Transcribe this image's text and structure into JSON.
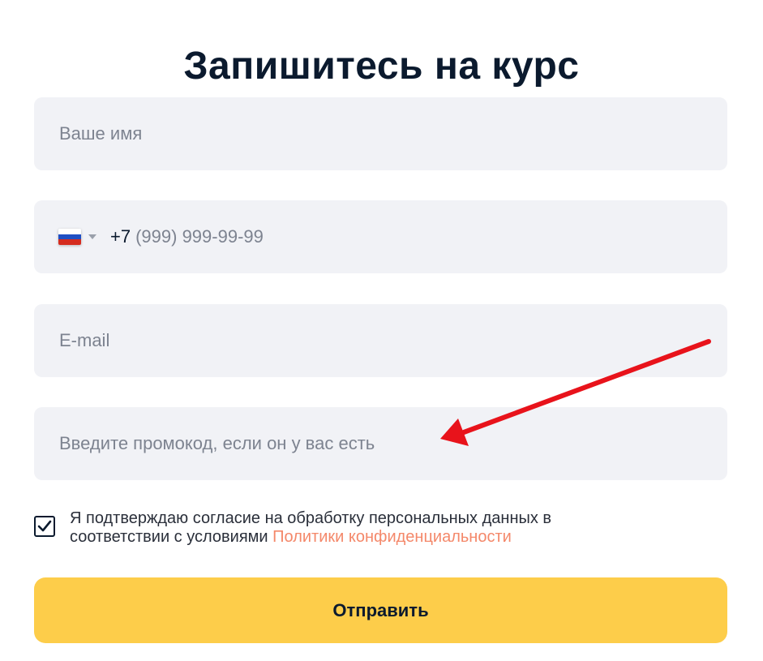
{
  "title": "Запишитесь на курс",
  "fields": {
    "name_placeholder": "Ваше имя",
    "phone_prefix": "+7",
    "phone_placeholder": "(999) 999-99-99",
    "email_placeholder": "E-mail",
    "promo_placeholder": "Введите промокод, если он у вас есть"
  },
  "consent": {
    "checked": true,
    "text": "Я подтверждаю согласие на обработку персональных данных в соответствии с условиями ",
    "link_text": "Политики конфиденциальности"
  },
  "submit_label": "Отправить",
  "colors": {
    "field_bg": "#f1f2f6",
    "button": "#fdcd4a",
    "link": "#f4886a",
    "annotation_arrow": "#e8131b"
  },
  "icons": {
    "country_flag": "russia-flag-icon",
    "dropdown": "caret-down-icon",
    "checkbox": "checkmark-icon",
    "annotation": "red-arrow-icon"
  }
}
